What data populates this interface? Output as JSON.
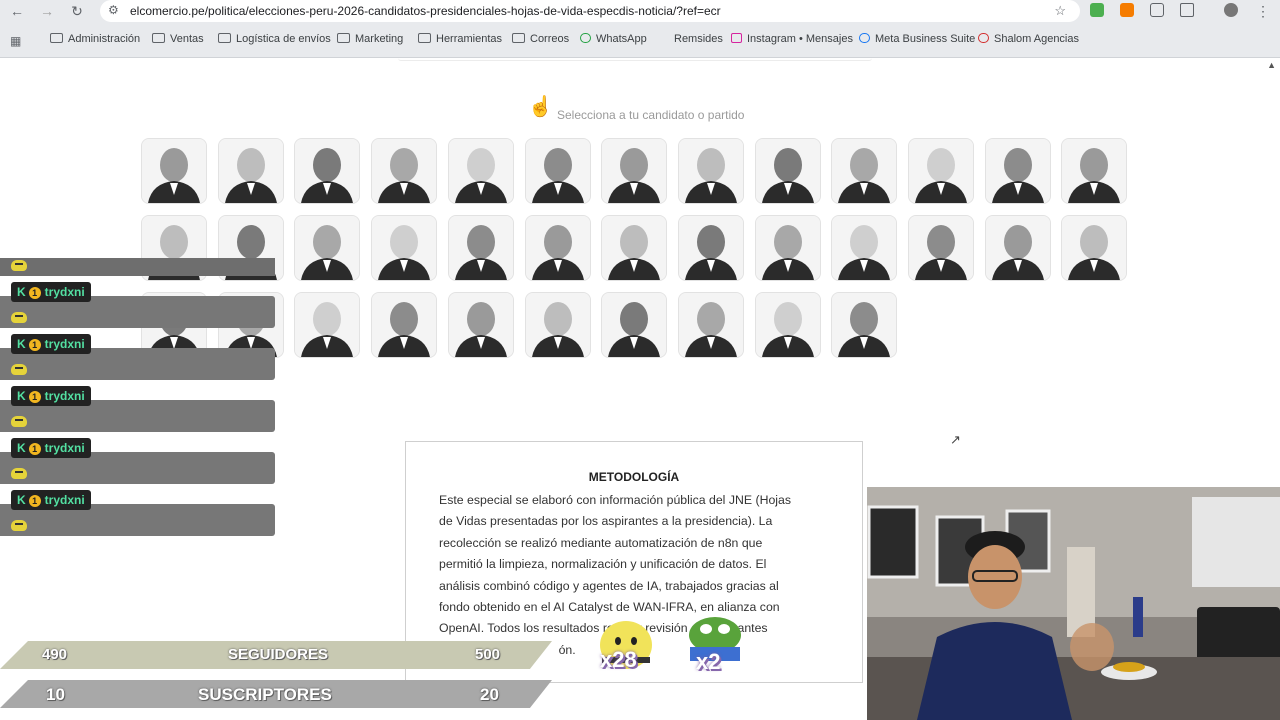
{
  "browser": {
    "url": "elcomercio.pe/politica/elecciones-peru-2026-candidatos-presidenciales-hojas-de-vida-especdis-noticia/?ref=ecr",
    "bookmarks": [
      "Administración",
      "Ventas",
      "Logística de envíos",
      "Marketing",
      "Herramientas",
      "Correos",
      "WhatsApp",
      "Remsides",
      "Instagram • Mensajes",
      "Meta Business Suite",
      "Shalom Agencias"
    ]
  },
  "page": {
    "select_prompt": "Selecciona a tu candidato o partido",
    "candidate_rows": [
      13,
      13,
      10
    ]
  },
  "methodology": {
    "title": "METODOLOGÍA",
    "lines": [
      "Este especial se elaboró con información pública del JNE (Hojas",
      "de Vidas presentadas por los aspirantes a la presidencia). La",
      "recolección se realizó mediante automatización de n8n que",
      "permitió la limpieza, normalización y unificación de datos. El",
      "análisis combinó código y agentes de IA, trabajados gracias al",
      "fondo obtenido en el AI Catalyst de WAN-IFRA, en alianza con",
      "OpenAI. Todos los resultados          ron por revisión editorial antes",
      "                                   ón."
    ]
  },
  "chat": {
    "username": "trydxni",
    "badge_letter": "K",
    "badge_num": "1",
    "messages": 5
  },
  "stream": {
    "followers": {
      "label": "SEGUIDORES",
      "current": "490",
      "goal": "500"
    },
    "subscribers": {
      "label": "SUSCRIPTORES",
      "current": "10",
      "goal": "20"
    },
    "stickers": [
      {
        "count": "x28"
      },
      {
        "count": "x2"
      }
    ]
  },
  "colors": {
    "chat_name": "#53e0a2",
    "followers_bar": "#c8c9b2",
    "subs_bar": "#a8a8a8"
  }
}
